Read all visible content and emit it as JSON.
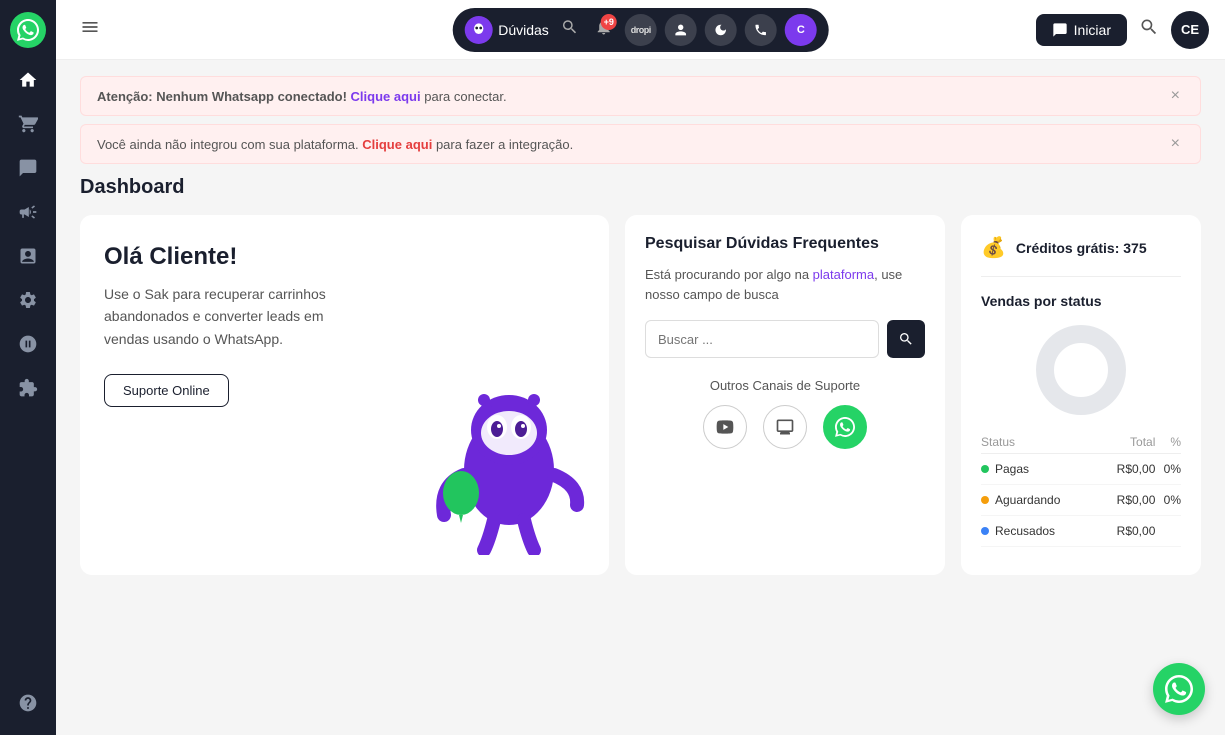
{
  "sidebar": {
    "items": [
      {
        "name": "home",
        "label": "Home",
        "icon": "home",
        "active": true
      },
      {
        "name": "cart",
        "label": "Carrinho",
        "icon": "cart"
      },
      {
        "name": "chat",
        "label": "Chat",
        "icon": "chat"
      },
      {
        "name": "megaphone",
        "label": "Campanhas",
        "icon": "megaphone"
      },
      {
        "name": "clipboard",
        "label": "Relatórios",
        "icon": "clipboard"
      },
      {
        "name": "settings",
        "label": "Configurações",
        "icon": "settings"
      },
      {
        "name": "robot",
        "label": "Automação",
        "icon": "robot"
      },
      {
        "name": "puzzle",
        "label": "Integrações",
        "icon": "puzzle"
      },
      {
        "name": "help",
        "label": "Ajuda",
        "icon": "help"
      }
    ]
  },
  "topbar": {
    "menu_label": "Menu",
    "nav": {
      "brand_name": "Dúvidas",
      "bell_badge": "+9",
      "avatar_text": "C",
      "nav_icons": [
        "dropi",
        "user",
        "moon",
        "phone"
      ]
    },
    "iniciar_label": "Iniciar",
    "user_initials": "CE"
  },
  "alerts": [
    {
      "id": "whatsapp-alert",
      "prefix": "Atenção: Nenhum Whatsapp conectado!",
      "link_text": "Clique aqui",
      "suffix": " para conectar."
    },
    {
      "id": "integration-alert",
      "prefix": "Você ainda não integrou com sua plataforma.",
      "link_text": "Clique aqui",
      "suffix": " para fazer a integração."
    }
  ],
  "dashboard": {
    "title": "Dashboard",
    "welcome_card": {
      "title": "Olá Cliente!",
      "description": "Use o Sak para recuperar carrinhos abandonados e converter leads em vendas usando o WhatsApp.",
      "button_label": "Suporte Online"
    },
    "faq_card": {
      "title": "Pesquisar Dúvidas Frequentes",
      "subtitle_text": "Está procurando por algo na plataforma, use nosso campo de busca",
      "search_placeholder": "Buscar ...",
      "search_button_label": "Buscar",
      "outros_canais_label": "Outros Canais de Suporte",
      "canal_icons": [
        {
          "name": "youtube",
          "label": "YouTube"
        },
        {
          "name": "screen",
          "label": "Tutoriais"
        },
        {
          "name": "whatsapp",
          "label": "WhatsApp"
        }
      ]
    },
    "stats_card": {
      "credits_icon": "💰",
      "credits_label": "Créditos grátis: 375",
      "vendas_title": "Vendas por status",
      "table_headers": [
        "Status",
        "Total",
        "%"
      ],
      "table_rows": [
        {
          "status": "Pagas",
          "dot": "green",
          "total": "R$0,00",
          "percent": "0%"
        },
        {
          "status": "Aguardando",
          "dot": "yellow",
          "total": "R$0,00",
          "percent": "0%"
        },
        {
          "status": "Recusados",
          "dot": "blue",
          "total": "R$0,00",
          "percent": ""
        }
      ],
      "pie_chart": {
        "segments": [
          {
            "color": "#e5e7eb",
            "value": 100
          }
        ]
      }
    }
  }
}
